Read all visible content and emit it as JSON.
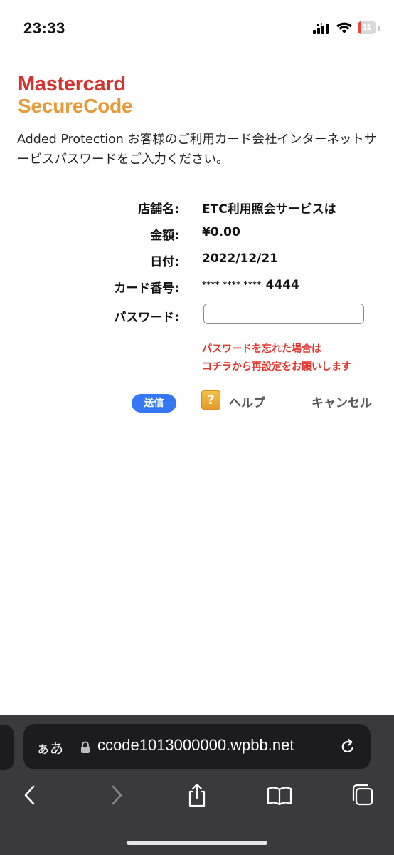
{
  "status_bar": {
    "time": "23:33",
    "battery": "11"
  },
  "logo": {
    "line1": "Mastercard",
    "line2": "SecureCode"
  },
  "intro_text": "Added Protection お客様のご利用カード会社インターネットサービスパスワードをご入力ください。",
  "details": {
    "merchant_label": "店舗名:",
    "merchant_value": "ETC利用照会サービスは",
    "amount_label": "金額:",
    "amount_value": "¥0.00",
    "date_label": "日付:",
    "date_value": "2022/12/21",
    "card_label": "カード番号:",
    "card_mask": "**** **** ****",
    "card_last4": "4444",
    "password_label": "パスワード:",
    "password_value": ""
  },
  "forgot_password": {
    "line1": "パスワードを忘れた場合は",
    "line2": "コチラから再設定をお願いします"
  },
  "actions": {
    "submit": "送信",
    "help_icon_glyph": "?",
    "help": "ヘルプ",
    "cancel": "キャンセル"
  },
  "browser": {
    "aa_label": "ぁあ",
    "url": "ccode1013000000.wpbb.net"
  },
  "colors": {
    "mastercard_red": "#d3342f",
    "securecode_orange": "#e69b3a",
    "link_red": "#e3342b",
    "submit_blue": "#3478f6"
  }
}
